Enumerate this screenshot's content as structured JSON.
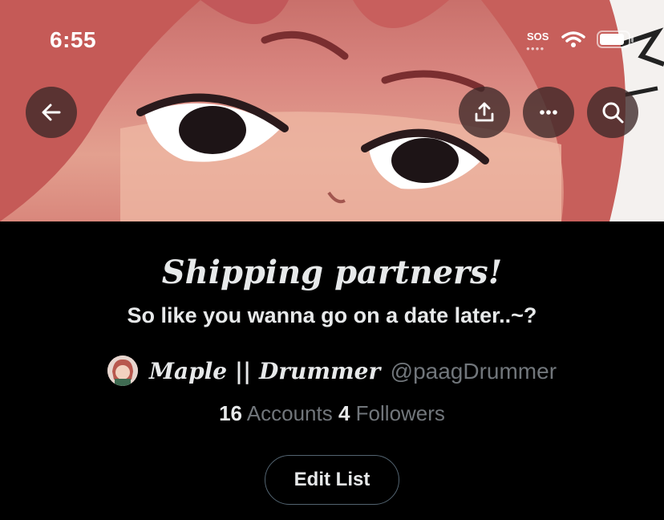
{
  "status_bar": {
    "time": "6:55",
    "sos_label": "SOS"
  },
  "header": {
    "back_icon": "arrow-left-icon",
    "share_icon": "share-icon",
    "more_icon": "more-horizontal-icon",
    "search_icon": "search-icon"
  },
  "list": {
    "title": "Shipping partners!",
    "description": "So like you wanna go on a date later..~?",
    "owner_name": "Maple || Drummer",
    "owner_handle": "@paagDrummer",
    "accounts_count": "16",
    "accounts_label": "Accounts",
    "followers_count": "4",
    "followers_label": "Followers"
  },
  "actions": {
    "edit_label": "Edit List"
  },
  "colors": {
    "background": "#000000",
    "text": "#e7e9ea",
    "muted": "#71767b",
    "border": "#536471"
  }
}
